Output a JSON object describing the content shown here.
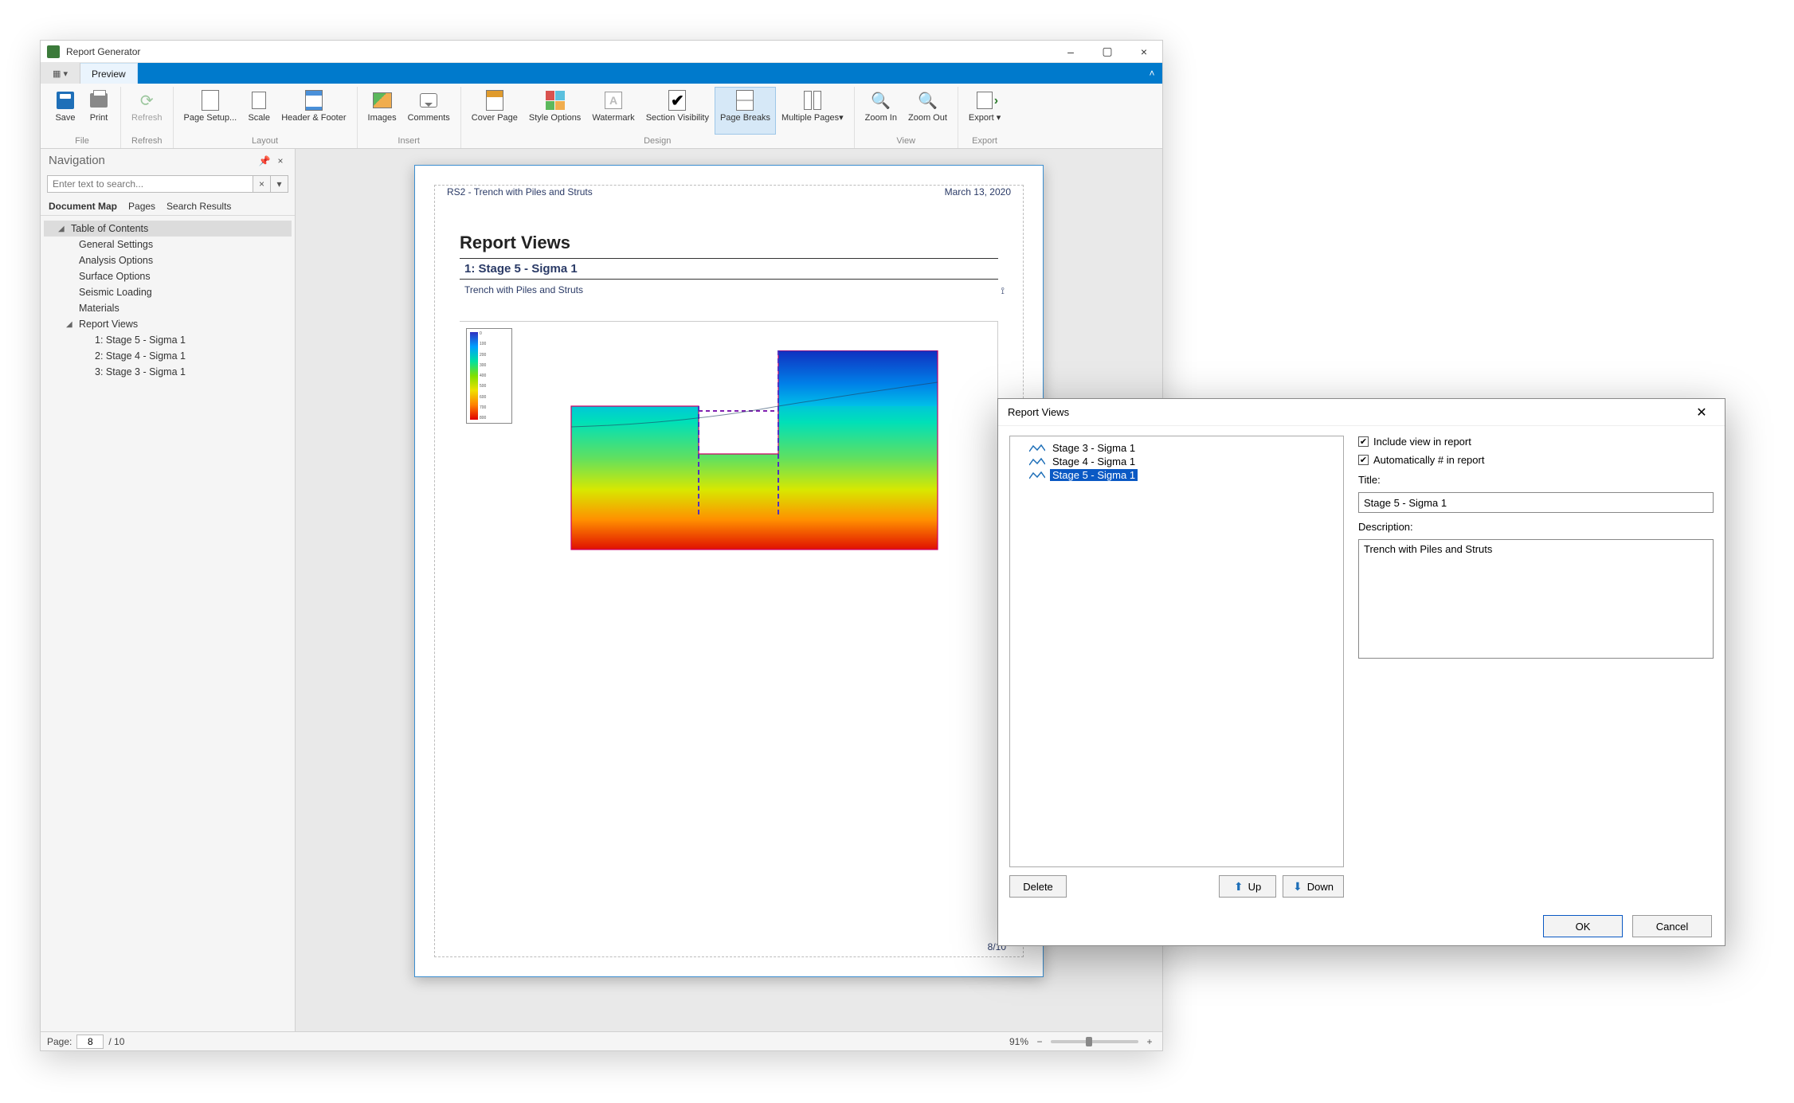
{
  "window": {
    "title": "Report Generator",
    "minimize": "–",
    "maximize": "▢",
    "close": "×"
  },
  "tabs": {
    "preview": "Preview"
  },
  "ribbon": {
    "file": {
      "label": "File",
      "save": "Save",
      "print": "Print"
    },
    "refresh": {
      "label": "Refresh",
      "refresh": "Refresh"
    },
    "layout": {
      "label": "Layout",
      "page_setup": "Page Setup...",
      "scale": "Scale",
      "header_footer": "Header & Footer"
    },
    "insert": {
      "label": "Insert",
      "images": "Images",
      "comments": "Comments"
    },
    "design": {
      "label": "Design",
      "cover_page": "Cover Page",
      "style_options": "Style Options",
      "watermark": "Watermark",
      "section_visibility": "Section Visibility",
      "page_breaks": "Page Breaks",
      "multiple_pages": "Multiple Pages▾"
    },
    "view": {
      "label": "View",
      "zoom_in": "Zoom In",
      "zoom_out": "Zoom Out"
    },
    "export": {
      "label": "Export",
      "export": "Export ▾"
    }
  },
  "nav": {
    "title": "Navigation",
    "search_placeholder": "Enter text to search...",
    "tabs": {
      "map": "Document Map",
      "pages": "Pages",
      "results": "Search Results"
    },
    "tree": {
      "toc": "Table of Contents",
      "general": "General Settings",
      "analysis": "Analysis Options",
      "surface": "Surface Options",
      "seismic": "Seismic Loading",
      "materials": "Materials",
      "report_views": "Report Views",
      "rv1": "1: Stage 5 - Sigma 1",
      "rv2": "2: Stage 4 - Sigma 1",
      "rv3": "3: Stage 3 - Sigma 1"
    }
  },
  "page": {
    "header_left": "RS2 - Trench with Piles and Struts",
    "header_right": "March 13, 2020",
    "heading": "Report Views",
    "section_title": "1: Stage 5 - Sigma 1",
    "section_sub": "Trench with Piles and Struts",
    "page_number": "8/10"
  },
  "status": {
    "page_label": "Page:",
    "current_page": "8",
    "total_pages": "/ 10",
    "zoom": "91%"
  },
  "dialog": {
    "title": "Report Views",
    "items": [
      {
        "label": "Stage 3 - Sigma 1",
        "selected": false
      },
      {
        "label": "Stage 4 - Sigma 1",
        "selected": false
      },
      {
        "label": "Stage 5 - Sigma 1",
        "selected": true
      }
    ],
    "delete": "Delete",
    "up": "Up",
    "down": "Down",
    "include": "Include view in report",
    "auto_num": "Automatically # in report",
    "title_label": "Title:",
    "title_value": "Stage 5 - Sigma 1",
    "desc_label": "Description:",
    "desc_value": "Trench with Piles and Struts",
    "ok": "OK",
    "cancel": "Cancel"
  }
}
